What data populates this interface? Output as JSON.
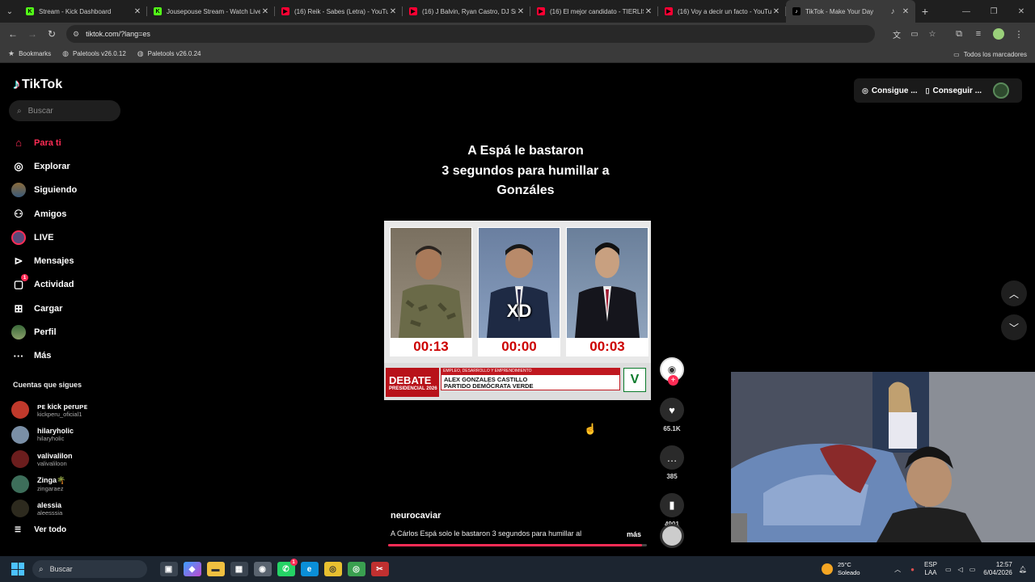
{
  "browser": {
    "tabs": [
      {
        "title": "Stream - Kick Dashboard",
        "color": "#53fc18",
        "glyph": "K"
      },
      {
        "title": "Jousepouse Stream - Watch Live",
        "color": "#53fc18",
        "glyph": "K"
      },
      {
        "title": "(16) Reik - Sabes (Letra) - YouTube",
        "color": "#ff0033",
        "glyph": "▶"
      },
      {
        "title": "(16) J Balvin, Ryan Castro, DJ Snake",
        "color": "#ff0033",
        "glyph": "▶"
      },
      {
        "title": "(16) El mejor candidato - TIERLIST",
        "color": "#ff0033",
        "glyph": "▶"
      },
      {
        "title": "(16) Voy a decir un facto - YouTube",
        "color": "#ff0033",
        "glyph": "▶"
      },
      {
        "title": "TikTok - Make Your Day",
        "color": "#000000",
        "glyph": "♪",
        "active": true
      }
    ],
    "url": "tiktok.com/?lang=es",
    "bookmarks": [
      "Bookmarks",
      "Paletools v26.0.12",
      "Paletools v26.0.24"
    ],
    "all_bookmarks": "Todos los marcadores"
  },
  "tiktok": {
    "logo": "TikTok",
    "search_placeholder": "Buscar",
    "nav": [
      {
        "label": "Para ti",
        "icon": "home-icon",
        "active": true
      },
      {
        "label": "Explorar",
        "icon": "compass-icon"
      },
      {
        "label": "Siguiendo",
        "icon": "following-avatar-icon"
      },
      {
        "label": "Amigos",
        "icon": "friends-icon"
      },
      {
        "label": "LIVE",
        "icon": "live-icon"
      },
      {
        "label": "Mensajes",
        "icon": "messages-icon"
      },
      {
        "label": "Actividad",
        "icon": "activity-icon",
        "badge": "1"
      },
      {
        "label": "Cargar",
        "icon": "upload-icon"
      },
      {
        "label": "Perfil",
        "icon": "profile-avatar-icon"
      },
      {
        "label": "Más",
        "icon": "more-icon"
      }
    ],
    "following_title": "Cuentas que sigues",
    "following": [
      {
        "name": "ᴘᴇ kick peruᴘᴇ",
        "handle": "kickperu_oficial1",
        "color": "#c0392b"
      },
      {
        "name": "hilaryholic",
        "handle": "hilaryholic",
        "color": "#7a8fa6"
      },
      {
        "name": "valivalilon",
        "handle": "valivaliloon",
        "color": "#6b1d1d"
      },
      {
        "name": "Zinga🌴",
        "handle": "zingaraez",
        "color": "#3d6e5a"
      },
      {
        "name": "alessia",
        "handle": "aleesssia",
        "color": "#2d2a1e"
      }
    ],
    "see_all": "Ver todo",
    "top_buttons": [
      "Consigue ...",
      "Conseguir ..."
    ],
    "video": {
      "caption_title": "A Espá le bastaron\n3 segundos para humillar a\nGonzáles",
      "timers": [
        "00:13",
        "00:00",
        "00:03"
      ],
      "overlay_text": "XD",
      "debate_label": "DEBATE",
      "debate_sub": "PRESIDENCIAL 2026",
      "strip_text": "EMPLEO, DESARROLLO Y EMPRENDIMIENTO",
      "name_line1": "ALEX GONZALES CASTILLO",
      "name_line2": "PARTIDO DEMÓCRATA VERDE",
      "party_logo": "V"
    },
    "author": "neurocaviar",
    "description": "A Cárlos Espá solo le bastaron 3 segundos para humillar al",
    "more": "más",
    "progress": 0.98,
    "likes": "65.1K",
    "comments": "385",
    "saves": "4901"
  },
  "taskbar": {
    "search": "Buscar",
    "weather_temp": "25°C",
    "weather_desc": "Soleado",
    "lang1": "ESP",
    "lang2": "LAA",
    "time": "12:57",
    "date": "6/04/2026",
    "whatsapp_badge": "1"
  }
}
